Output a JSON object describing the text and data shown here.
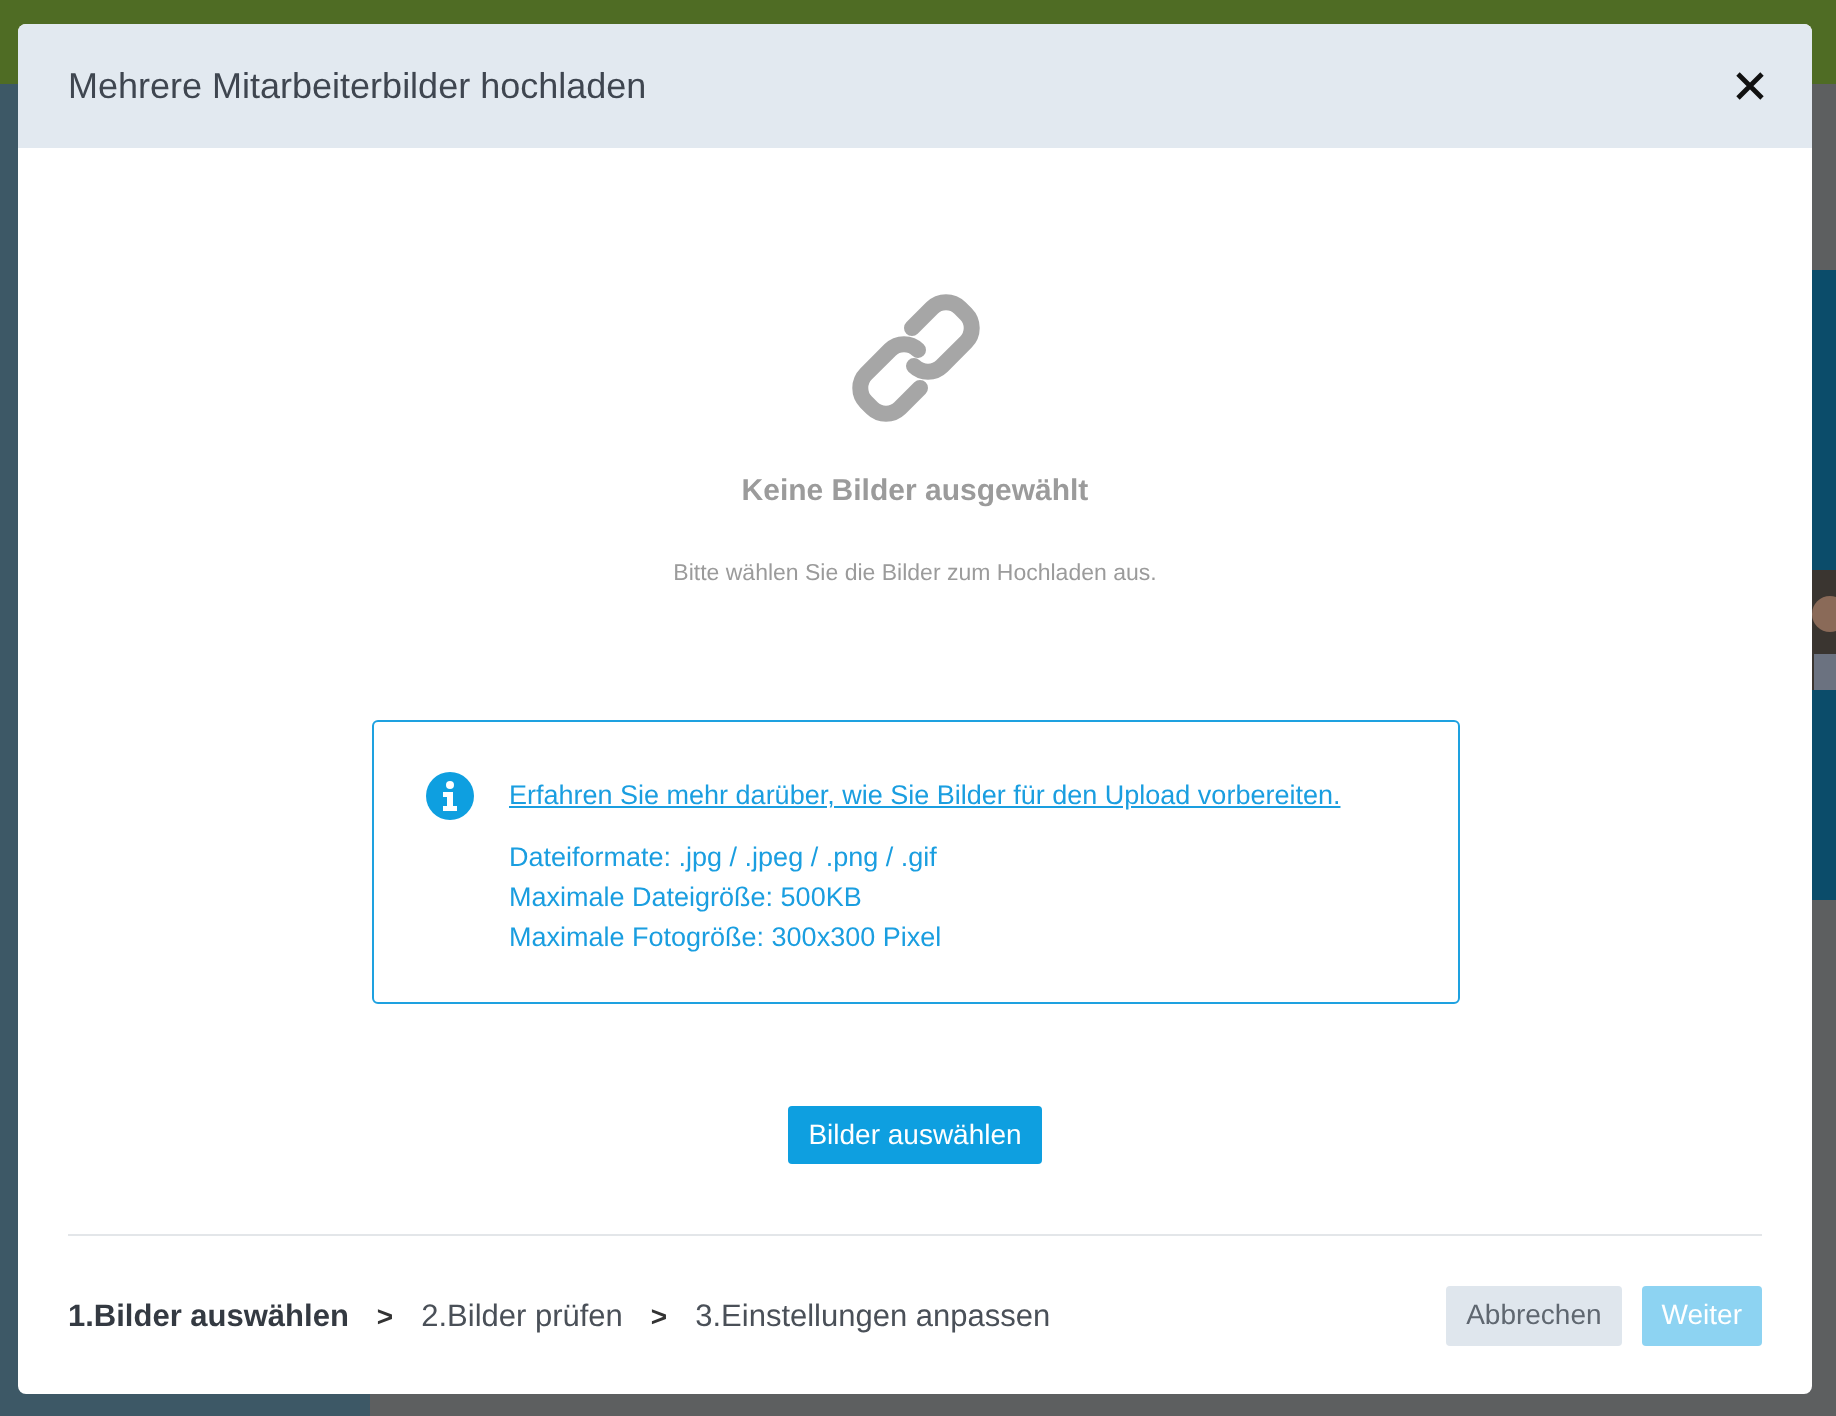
{
  "dialog": {
    "title": "Mehrere Mitarbeiterbilder hochladen"
  },
  "empty_state": {
    "heading": "Keine Bilder ausgewählt",
    "hint": "Bitte wählen Sie die Bilder zum Hochladen aus."
  },
  "info_box": {
    "link": "Erfahren Sie mehr darüber, wie Sie Bilder für den Upload vorbereiten.",
    "lines": [
      "Dateiformate: .jpg / .jpeg / .png / .gif",
      "Maximale Dateigröße: 500KB",
      "Maximale Fotogröße: 300x300 Pixel"
    ]
  },
  "select_button": "Bilder auswählen",
  "steps": [
    {
      "label": "1.Bilder auswählen",
      "selected": true
    },
    {
      "label": "2.Bilder prüfen",
      "selected": false
    },
    {
      "label": "3.Einstellungen anpassen",
      "selected": false
    }
  ],
  "step_separator": ">",
  "buttons": [
    {
      "label": "Abbrechen",
      "kind": "secondary",
      "disabled": false
    },
    {
      "label": "Weiter",
      "kind": "primary",
      "disabled": true
    }
  ]
}
